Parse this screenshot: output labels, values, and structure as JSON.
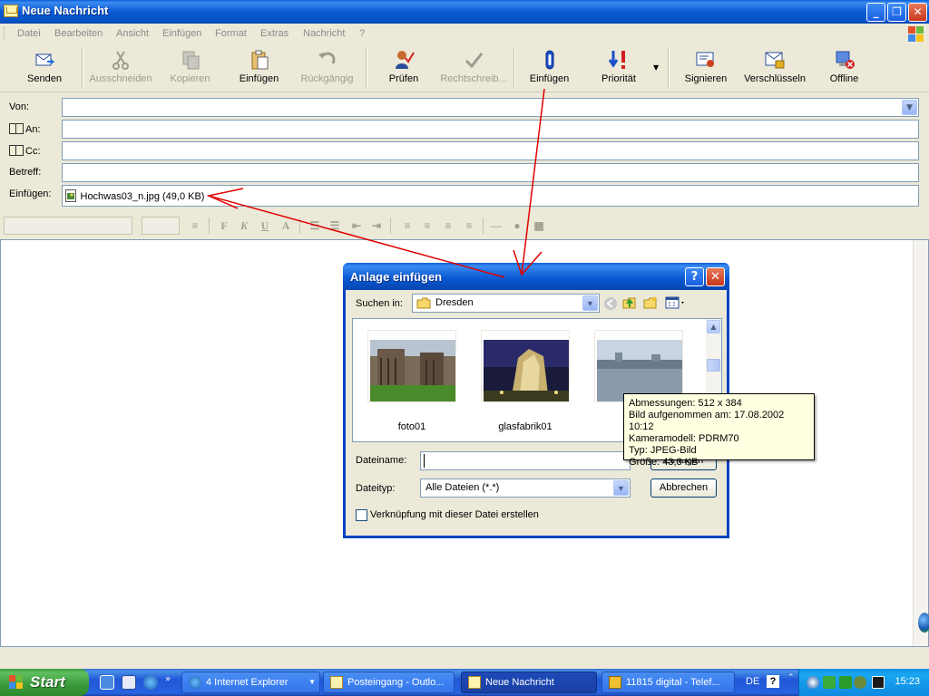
{
  "window": {
    "title": "Neue Nachricht"
  },
  "menu": [
    "Datei",
    "Bearbeiten",
    "Ansicht",
    "Einfügen",
    "Format",
    "Extras",
    "Nachricht",
    "?"
  ],
  "toolbar": {
    "send": "Senden",
    "cut": "Ausschneiden",
    "copy": "Kopieren",
    "paste": "Einfügen",
    "undo": "Rückgängig",
    "check": "Prüfen",
    "spelling": "Rechtschreib...",
    "attach": "Einfügen",
    "priority": "Priorität",
    "sign": "Signieren",
    "encrypt": "Verschlüsseln",
    "offline": "Offline"
  },
  "header": {
    "from_label": "Von:",
    "to_label": "An:",
    "cc_label": "Cc:",
    "subject_label": "Betreff:",
    "attach_label": "Einfügen:",
    "attachment": "Hochwas03_n.jpg (49,0 KB)"
  },
  "format_bar": {
    "bold": "F",
    "italic": "K",
    "underline": "U"
  },
  "dialog": {
    "title": "Anlage einfügen",
    "lookin_label": "Suchen in:",
    "lookin_value": "Dresden",
    "files": [
      {
        "name": "foto01"
      },
      {
        "name": "glasfabrik01"
      },
      {
        "name": "Hoc"
      }
    ],
    "filename_label": "Dateiname:",
    "filename_value": "",
    "filetype_label": "Dateityp:",
    "filetype_value": "Alle Dateien (*.*)",
    "insert_button": "Einfügen",
    "cancel_button": "Abbrechen",
    "link_checkbox": "Verknüpfung mit dieser Datei erstellen"
  },
  "tooltip": {
    "dimensions": "Abmessungen: 512 x 384",
    "taken": "Bild aufgenommen am: 17.08.2002 10:12",
    "camera": "Kameramodell: PDRM70",
    "type": "Typ: JPEG-Bild",
    "size": "Größe: 43,3 KB"
  },
  "taskbar": {
    "start": "Start",
    "tasks": [
      {
        "label": "4 Internet Explorer"
      },
      {
        "label": "Posteingang - Outlo..."
      },
      {
        "label": "Neue Nachricht"
      },
      {
        "label": "11815 digital - Telef..."
      }
    ],
    "language": "DE",
    "clock": "15:23"
  },
  "colors": {
    "accent": "#0a5fd8",
    "annotation": "#e00000",
    "tooltip_bg": "#ffffe1"
  }
}
